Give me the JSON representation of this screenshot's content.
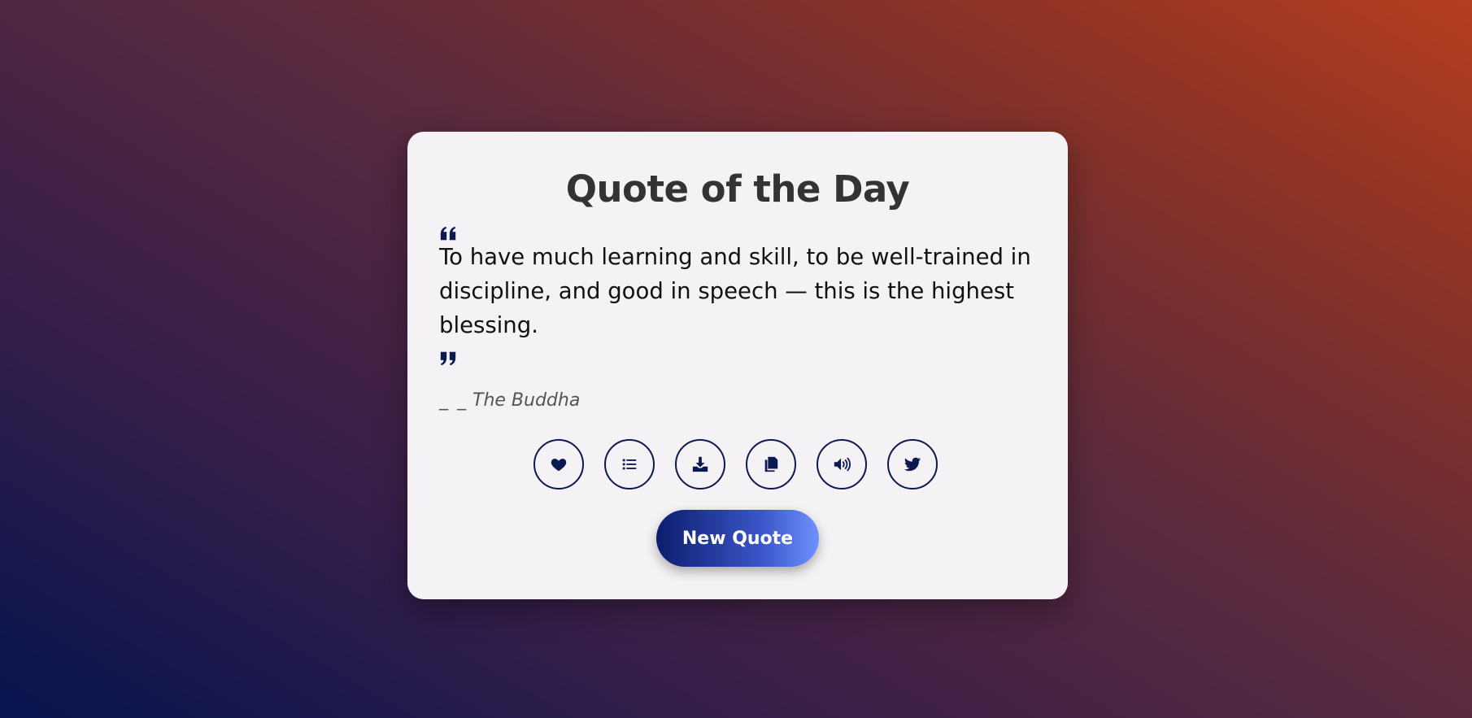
{
  "card": {
    "title": "Quote of the Day",
    "quote": "To have much learning and skill, to be well-trained in discipline, and good in speech — this is the highest blessing.",
    "author_prefix": "_ _",
    "author": "The Buddha"
  },
  "actions": [
    {
      "icon": "heart-icon"
    },
    {
      "icon": "list-icon"
    },
    {
      "icon": "download-icon"
    },
    {
      "icon": "copy-icon"
    },
    {
      "icon": "speaker-icon"
    },
    {
      "icon": "twitter-icon"
    }
  ],
  "new_quote_label": "New Quote",
  "colors": {
    "accent": "#0c1850",
    "card_bg": "#f4f2f4",
    "title": "#333333"
  }
}
